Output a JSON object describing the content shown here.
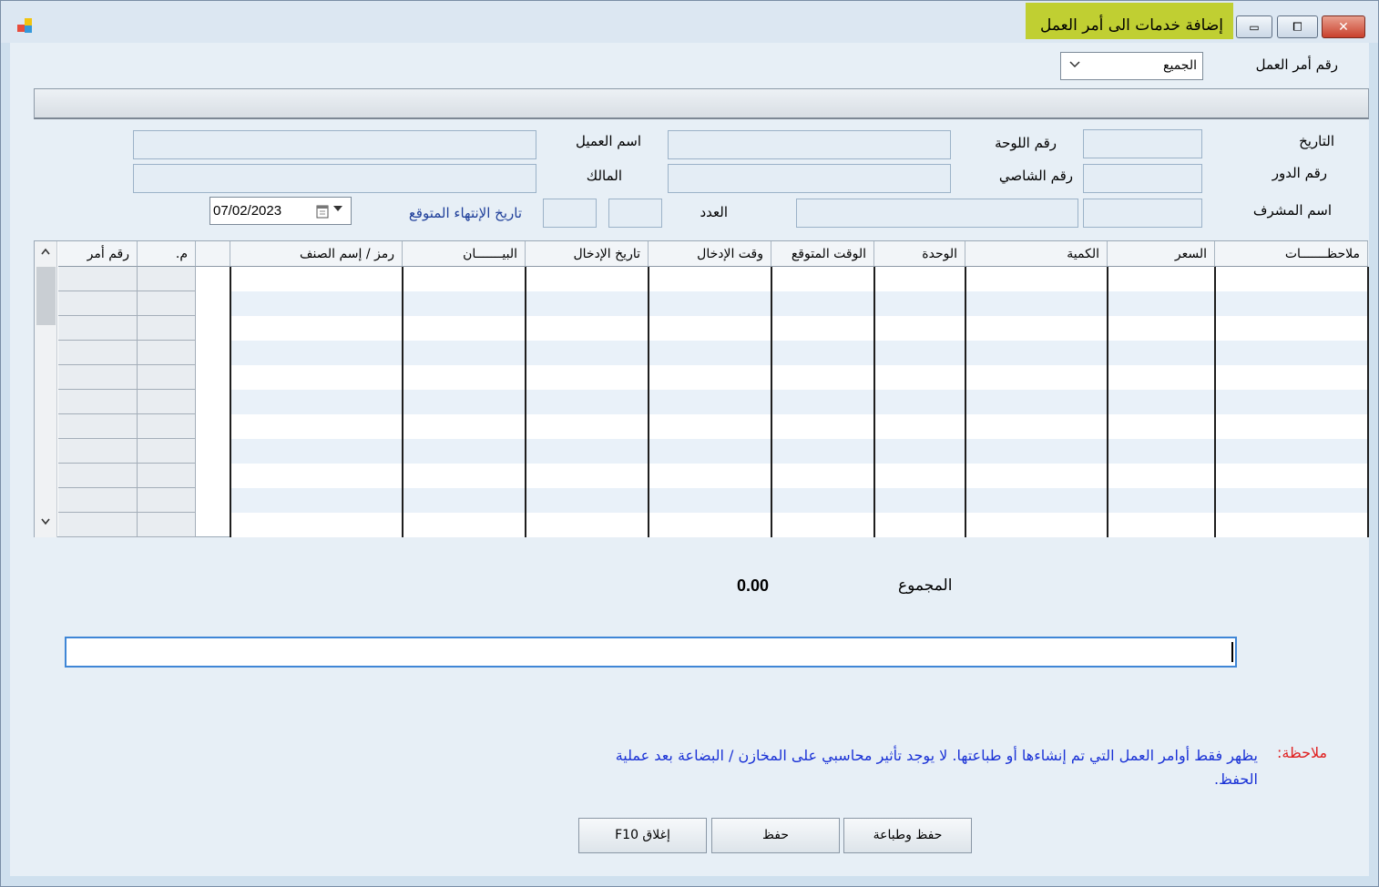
{
  "window": {
    "title": "إضافة خدمات الى أمر العمل",
    "minimize_glyph": "▭",
    "maximize_glyph": "⧠",
    "close_glyph": "✕"
  },
  "order": {
    "label": "رقم أمر العمل",
    "selected": "الجميع"
  },
  "form": {
    "date_label": "التاريخ",
    "turn_label": "رقم الدور",
    "supervisor_label": "اسم المشرف",
    "plate_label": "رقم اللوحة",
    "chassis_label": "رقم الشاصي",
    "count_label": "العدد",
    "customer_label": "اسم العميل",
    "owner_label": "المالك",
    "expected_end_label": "تاريخ الإنتهاء المتوقع",
    "expected_end_value": "07/02/2023"
  },
  "grid": {
    "columns": [
      "ملاحظـــــــات",
      "السعر",
      "الكمية",
      "الوحدة",
      "الوقت المتوقع",
      "وقت الإدخال",
      "تاريخ الإدخال",
      "البيـــــــان",
      "رمز / إسم الصنف",
      "",
      "م.",
      "رقم أمر"
    ]
  },
  "total": {
    "label": "المجموع",
    "value": "0.00"
  },
  "note": {
    "title": "ملاحظة:",
    "text": "يظهر فقط أوامر العمل التي تم إنشاءها أو طباعتها. لا يوجد تأثير محاسبي على المخازن / البضاعة بعد عملية الحفظ."
  },
  "buttons": {
    "save_print": "حفظ وطباعة",
    "save": "حفظ",
    "close": "إغلاق F10"
  },
  "colors": {
    "title_highlight": "#c0cf32",
    "note_red": "#e02020",
    "note_blue": "#1a32d6",
    "link_blue": "#1f3f9a"
  }
}
